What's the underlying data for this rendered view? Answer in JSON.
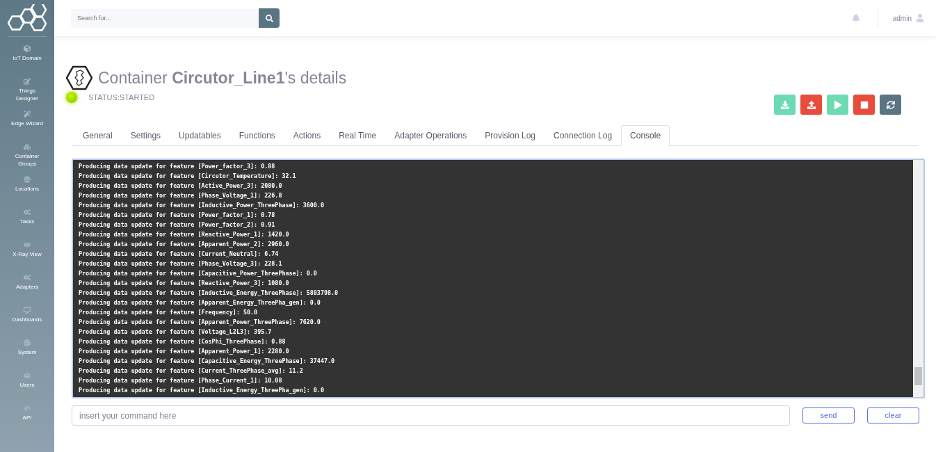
{
  "sidebar": {
    "items": [
      {
        "label": "IoT Domain",
        "kind": "cube"
      },
      {
        "label": "Things Designer",
        "kind": "edit"
      },
      {
        "label": "Edge Wizard",
        "kind": "wand"
      },
      {
        "label": "Container Groups",
        "kind": "cubes"
      },
      {
        "label": "Locations",
        "kind": "globe"
      },
      {
        "label": "Tasks",
        "kind": "cogs"
      },
      {
        "label": "X-Ray View",
        "kind": "eye"
      },
      {
        "label": "Adapters",
        "kind": "cogs"
      },
      {
        "label": "Dashboards",
        "kind": "screen"
      },
      {
        "label": "System",
        "kind": "globe"
      },
      {
        "label": "Users",
        "kind": "users"
      },
      {
        "label": "API",
        "kind": "code"
      }
    ]
  },
  "topbar": {
    "search": {
      "placeholder": "Search for..."
    },
    "user": "admin"
  },
  "header": {
    "title": "Container **Circutor_Line1**'s details",
    "status": "STATUS:STARTED",
    "running": true
  },
  "actions": [
    {
      "kind": "download"
    },
    {
      "kind": "upload"
    },
    {
      "kind": "play"
    },
    {
      "kind": "stop"
    },
    {
      "kind": "refresh"
    }
  ],
  "tabs": [
    {
      "label": "General",
      "selected": false
    },
    {
      "label": "Settings",
      "selected": false
    },
    {
      "label": "Updatables",
      "selected": false
    },
    {
      "label": "Functions",
      "selected": false
    },
    {
      "label": "Actions",
      "selected": false
    },
    {
      "label": "Real Time",
      "selected": false
    },
    {
      "label": "Adapter Operations",
      "selected": false
    },
    {
      "label": "Provision Log",
      "selected": false
    },
    {
      "label": "Connection Log",
      "selected": false
    },
    {
      "label": "Console",
      "selected": true
    }
  ],
  "console": {
    "lines": [
      "Producing data update for feature [Power_factor_3]: 0.88",
      "Producing data update for feature [Circutor_Temperature]: 32.1",
      "Producing data update for feature [Active_Power_3]: 2080.0",
      "Producing data update for feature [Phase_Voltage_1]: 226.8",
      "Producing data update for feature [Inductive_Power_ThreePhase]: 3600.0",
      "Producing data update for feature [Power_factor_1]: 0.78",
      "Producing data update for feature [Power_factor_2]: 0.91",
      "Producing data update for feature [Reactive_Power_1]: 1420.0",
      "Producing data update for feature [Apparent_Power_2]: 2960.0",
      "Producing data update for feature [Current_Neutral]: 6.74",
      "Producing data update for feature [Phase_Voltage_3]: 228.1",
      "Producing data update for feature [Capacitive_Power_ThreePhase]: 0.0",
      "Producing data update for feature [Reactive_Power_3]: 1080.0",
      "Producing data update for feature [Inductive_Energy_ThreePhase]: 5803798.0",
      "Producing data update for feature [Apparent_Energy_ThreePha_gen]: 0.0",
      "Producing data update for feature [Frequency]: 50.0",
      "Producing data update for feature [Apparent_Power_ThreePhase]: 7620.0",
      "Producing data update for feature [Voltage_L2L3]: 395.7",
      "Producing data update for feature [CosPhi_ThreePhase]: 0.88",
      "Producing data update for feature [Apparent_Power_1]: 2280.0",
      "Producing data update for feature [Capacitive_Energy_ThreePhase]: 37447.0",
      "Producing data update for feature [Current_ThreePhase_avg]: 11.2",
      "Producing data update for feature [Phase_Current_1]: 10.08",
      "Producing data update for feature [Inductive_Energy_ThreePha_gen]: 0.0"
    ],
    "command": {
      "placeholder": "insert your command here"
    },
    "buttons": [
      "send",
      "clear"
    ]
  }
}
